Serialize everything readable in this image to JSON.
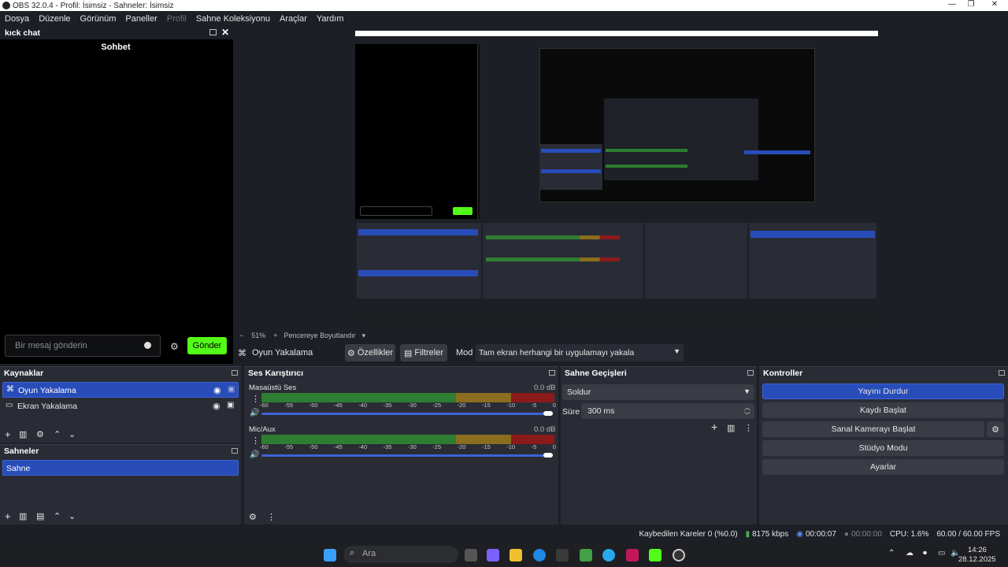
{
  "window": {
    "title": "OBS 32.0.4 - Profil: İsimsiz - Sahneler: İsimsiz"
  },
  "menu": [
    "Dosya",
    "Düzenle",
    "Görünüm",
    "Paneller",
    "Profil",
    "Sahne Koleksiyonu",
    "Araçlar",
    "Yardım"
  ],
  "chat": {
    "dock_title": "kıck chat",
    "header": "Sohbet",
    "placeholder": "Bir mesaj gönderin",
    "send": "Gönder"
  },
  "preview": {
    "zoom": "51%",
    "resize": "Pencereye Boyutlandır"
  },
  "source_toolbar": {
    "source": "Oyun Yakalama",
    "properties": "Özellikler",
    "filters": "Filtreler",
    "mode_label": "Mod",
    "mode_value": "Tam ekran herhangi bir uygulamayı yakala"
  },
  "sources": {
    "title": "Kaynaklar",
    "items": [
      "Oyun Yakalama",
      "Ekran Yakalama"
    ]
  },
  "scenes": {
    "title": "Sahneler",
    "items": [
      "Sahne"
    ]
  },
  "mixer": {
    "title": "Ses Karıştırıcı",
    "channels": [
      {
        "name": "Masaüstü Ses",
        "db": "0.0 dB"
      },
      {
        "name": "Mic/Aux",
        "db": "0.0 dB"
      }
    ],
    "ticks": [
      "-60",
      "-55",
      "-50",
      "-45",
      "-40",
      "-35",
      "-30",
      "-25",
      "-20",
      "-15",
      "-10",
      "-5",
      "0"
    ]
  },
  "transitions": {
    "title": "Sahne Geçişleri",
    "type": "Soldur",
    "duration_label": "Süre",
    "duration": "300 ms"
  },
  "controls": {
    "title": "Kontroller",
    "buttons": [
      "Yayını Durdur",
      "Kaydı Başlat",
      "Sanal Kamerayı Başlat",
      "Stüdyo Modu",
      "Ayarlar"
    ]
  },
  "status": {
    "dropped": "Kaybedilen Kareler 0 (%0.0)",
    "bitrate": "8175 kbps",
    "stream_time": "00:00:07",
    "rec_time": "00:00:00",
    "cpu": "CPU: 1.6%",
    "fps": "60.00 / 60.00 FPS"
  },
  "taskbar": {
    "search": "Ara",
    "time": "14:26",
    "date": "28.12.2025"
  },
  "colors": {
    "accent": "#284cb8",
    "kick_green": "#53fc18",
    "panel": "#2a2c35",
    "bg": "#1d1f26"
  }
}
